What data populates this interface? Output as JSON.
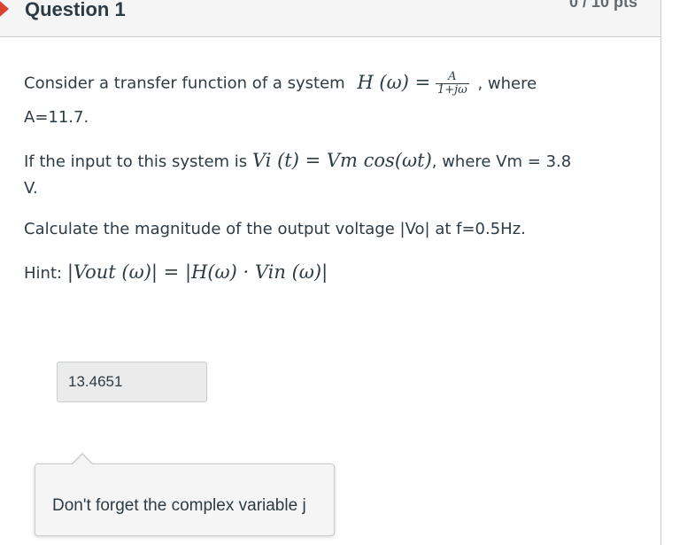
{
  "question": {
    "title": "Question 1",
    "points": "0 / 10 pts"
  },
  "body": {
    "line1_text": "Consider a transfer function of a system",
    "tf_lhs": "H (ω) =",
    "tf_num": "A",
    "tf_den": "1+jω",
    "line1_tail": ", where",
    "line2": "A=11.7.",
    "line3_pre": "If the input to this system is",
    "input_math": "Vi (t) = Vm cos(ωt)",
    "line3_post": ", where Vm = 3.8",
    "line4": "V.",
    "line5": "Calculate the magnitude of the output voltage |Vo| at f=0.5Hz.",
    "hint_label": "Hint:",
    "hint_math": "|Vout (ω)| = |H(ω) · Vin (ω)|"
  },
  "answer": {
    "value": "13.4651"
  },
  "comment": {
    "text": "Don't forget the complex variable j"
  },
  "colors": {
    "flag": "#d9432f",
    "text": "#2d3b45",
    "header_bg": "#f5f5f5",
    "border": "#c7cdd1"
  }
}
